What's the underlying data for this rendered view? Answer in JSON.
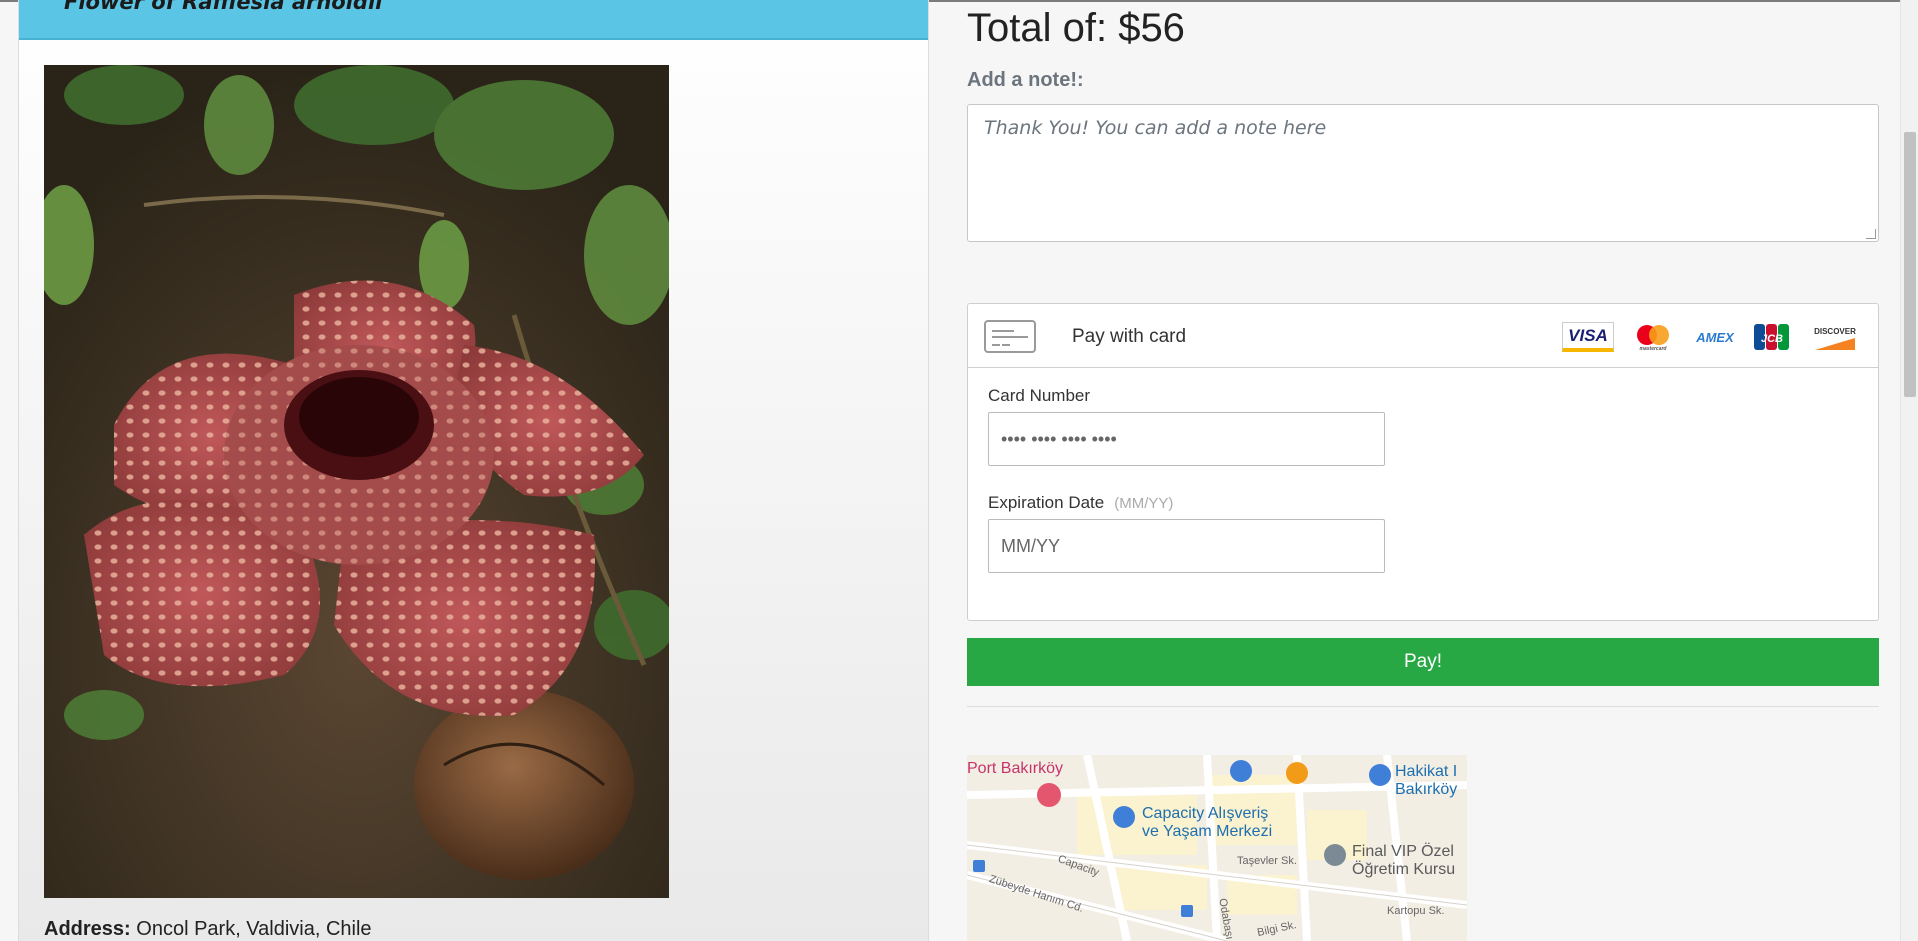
{
  "listing": {
    "title": "Flower of Rafflesia arnoldii",
    "address_label": "Address:",
    "address_value": "Oncol Park, Valdivia, Chile"
  },
  "checkout": {
    "total": "Total of: $56",
    "note_label": "Add a note!:",
    "note_placeholder": "Thank You! You can add a note here",
    "note_value": "",
    "pay_with_card": "Pay with card",
    "card_logos": [
      "VISA",
      "mastercard",
      "AMEX",
      "JCB",
      "DISCOVER"
    ],
    "card_number_label": "Card Number",
    "card_number_placeholder": "•••• •••• •••• ••••",
    "expiration_label": "Expiration Date",
    "expiration_hint": "(MM/YY)",
    "expiration_placeholder": "MM/YY",
    "pay_button": "Pay!"
  },
  "map": {
    "places": [
      "Port Bakırköy",
      "Capacity Alışveriş",
      "ve Yaşam Merkezi",
      "Hakikat I",
      "Bakırköy",
      "Final VIP Özel",
      "Öğretim Kursu"
    ],
    "streets": [
      "Capacity",
      "Taşevler Sk.",
      "Zübeyde Hanım Cd.",
      "Odabaşı",
      "Bilgi Sk.",
      "Kartopu Sk."
    ]
  },
  "colors": {
    "header_bg": "#5bc5e5",
    "pay_button_bg": "#28a745"
  }
}
